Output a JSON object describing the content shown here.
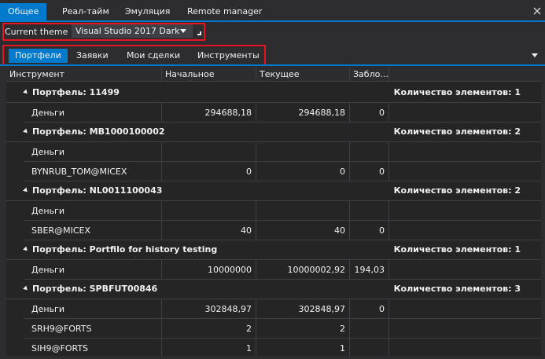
{
  "top_tabs": [
    "Общее",
    "Реал-тайм",
    "Эмуляция",
    "Remote manager"
  ],
  "theme": {
    "label": "Current theme",
    "value": "Visual Studio 2017 Dark"
  },
  "inner_tabs": [
    "Портфели",
    "Заявки",
    "Мои сделки",
    "Инструменты"
  ],
  "grid": {
    "columns": [
      "Инструмент",
      "Начальное",
      "Текущее",
      "Забло..."
    ],
    "groups": [
      {
        "title": "Портфель: 11499",
        "count": "Количество элементов: 1",
        "rows": [
          [
            "Деньги",
            "294688,18",
            "294688,18",
            "0"
          ]
        ]
      },
      {
        "title": "Портфель: MB1000100002",
        "count": "Количество элементов: 2",
        "rows": [
          [
            "Деньги",
            "",
            "",
            ""
          ],
          [
            "BYNRUB_TOM@MICEX",
            "0",
            "0",
            "0"
          ]
        ]
      },
      {
        "title": "Портфель: NL0011100043",
        "count": "Количество элементов: 2",
        "rows": [
          [
            "Деньги",
            "",
            "",
            ""
          ],
          [
            "SBER@MICEX",
            "40",
            "40",
            "0"
          ]
        ]
      },
      {
        "title": "Портфель: Portfilo for history testing",
        "count": "Количество элементов: 1",
        "rows": [
          [
            "Деньги",
            "10000000",
            "10000002,92",
            "194,03"
          ]
        ]
      },
      {
        "title": "Портфель: SPBFUT00846",
        "count": "Количество элементов: 3",
        "rows": [
          [
            "Деньги",
            "302848,97",
            "302848,97",
            "0"
          ],
          [
            "SRH9@FORTS",
            "2",
            "2",
            ""
          ],
          [
            "SIH9@FORTS",
            "1",
            "1",
            ""
          ]
        ]
      }
    ]
  }
}
